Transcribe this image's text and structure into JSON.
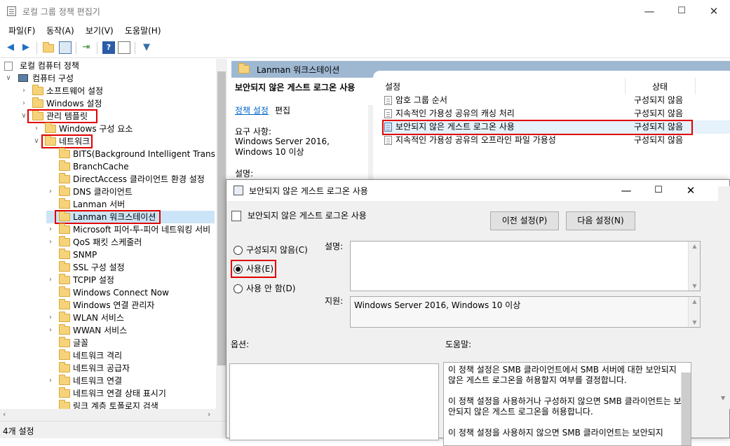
{
  "window": {
    "title": "로컬 그룹 정책 편집기",
    "minimize": "—",
    "maximize": "☐",
    "close": "✕"
  },
  "menu": [
    "파일(F)",
    "동작(A)",
    "보기(V)",
    "도움말(H)"
  ],
  "toolbar_icons": [
    "back-arrow-icon",
    "forward-arrow-icon",
    "up-folder-icon",
    "show-tree-icon",
    "export-icon",
    "help-icon",
    "properties-icon",
    "filter-icon"
  ],
  "tree": {
    "root": "로컬 컴퓨터 정책",
    "computer": "컴퓨터 구성",
    "software": "소프트웨어 설정",
    "windows_settings": "Windows 설정",
    "admin_templates": "관리 템플릿",
    "windows_components": "Windows 구성 요소",
    "network": "네트워크",
    "network_children": [
      "BITS(Background Intelligent Transfer S",
      "BranchCache",
      "DirectAccess 클라이언트 환경 설정",
      "DNS 클라이언트",
      "Lanman 서버",
      "Lanman 워크스테이션",
      "Microsoft 피어-투-피어 네트워킹 서비",
      "QoS 패킷 스케줄러",
      "SNMP",
      "SSL 구성 설정",
      "TCPIP 설정",
      "Windows Connect Now",
      "Windows 연결 관리자",
      "WLAN 서비스",
      "WWAN 서비스",
      "글꼴",
      "네트워크 격리",
      "네트워크 공급자",
      "네트워크 연결",
      "네트워크 연결 상태 표시기",
      "링크 계층 토폴로지 검색"
    ]
  },
  "status": "4개 설정",
  "right_pane": {
    "header": "Lanman 워크스테이션",
    "desc_title": "보안되지 않은 게스트 로그온 사용",
    "edit_link": "정책 설정",
    "edit_suffix": "편집",
    "requirement_label": "요구 사항:",
    "requirement_value": "Windows Server 2016, Windows 10 이상",
    "description_label": "설명:",
    "col_setting": "설정",
    "col_state": "상태",
    "rows": [
      {
        "name": "암호 그룹 순서",
        "state": "구성되지 않음"
      },
      {
        "name": "지속적인 가용성 공유의 캐싱 처리",
        "state": "구성되지 않음"
      },
      {
        "name": "보안되지 않은 게스트 로그온 사용",
        "state": "구성되지 않음"
      },
      {
        "name": "지속적인 가용성 공유의 오프라인 파일 가용성",
        "state": "구성되지 않음"
      }
    ]
  },
  "dialog": {
    "title": "보안되지 않은 게스트 로그온 사용",
    "setting_title": "보안되지 않은 게스트 로그온 사용",
    "prev_button": "이전 설정(P)",
    "next_button": "다음 설정(N)",
    "radio_not_configured": "구성되지 않음(C)",
    "radio_enabled": "사용(E)",
    "radio_disabled": "사용 안 함(D)",
    "selected": "enabled",
    "comment_label": "설명:",
    "supported_label": "지원:",
    "supported_value": "Windows Server 2016, Windows 10 이상",
    "options_label": "옵션:",
    "help_label": "도움말:",
    "help_paragraphs": [
      "이 정책 설정은 SMB 클라이언트에서 SMB 서버에 대한 보안되지 않은 게스트 로그온을 허용할지 여부를 결정합니다.",
      "이 정책 설정을 사용하거나 구성하지 않으면 SMB 클라이언트는 보안되지 않은 게스트 로그온을 허용합니다.",
      "이 정책 설정을 사용하지 않으면 SMB 클라이언트는 보안되지"
    ]
  }
}
